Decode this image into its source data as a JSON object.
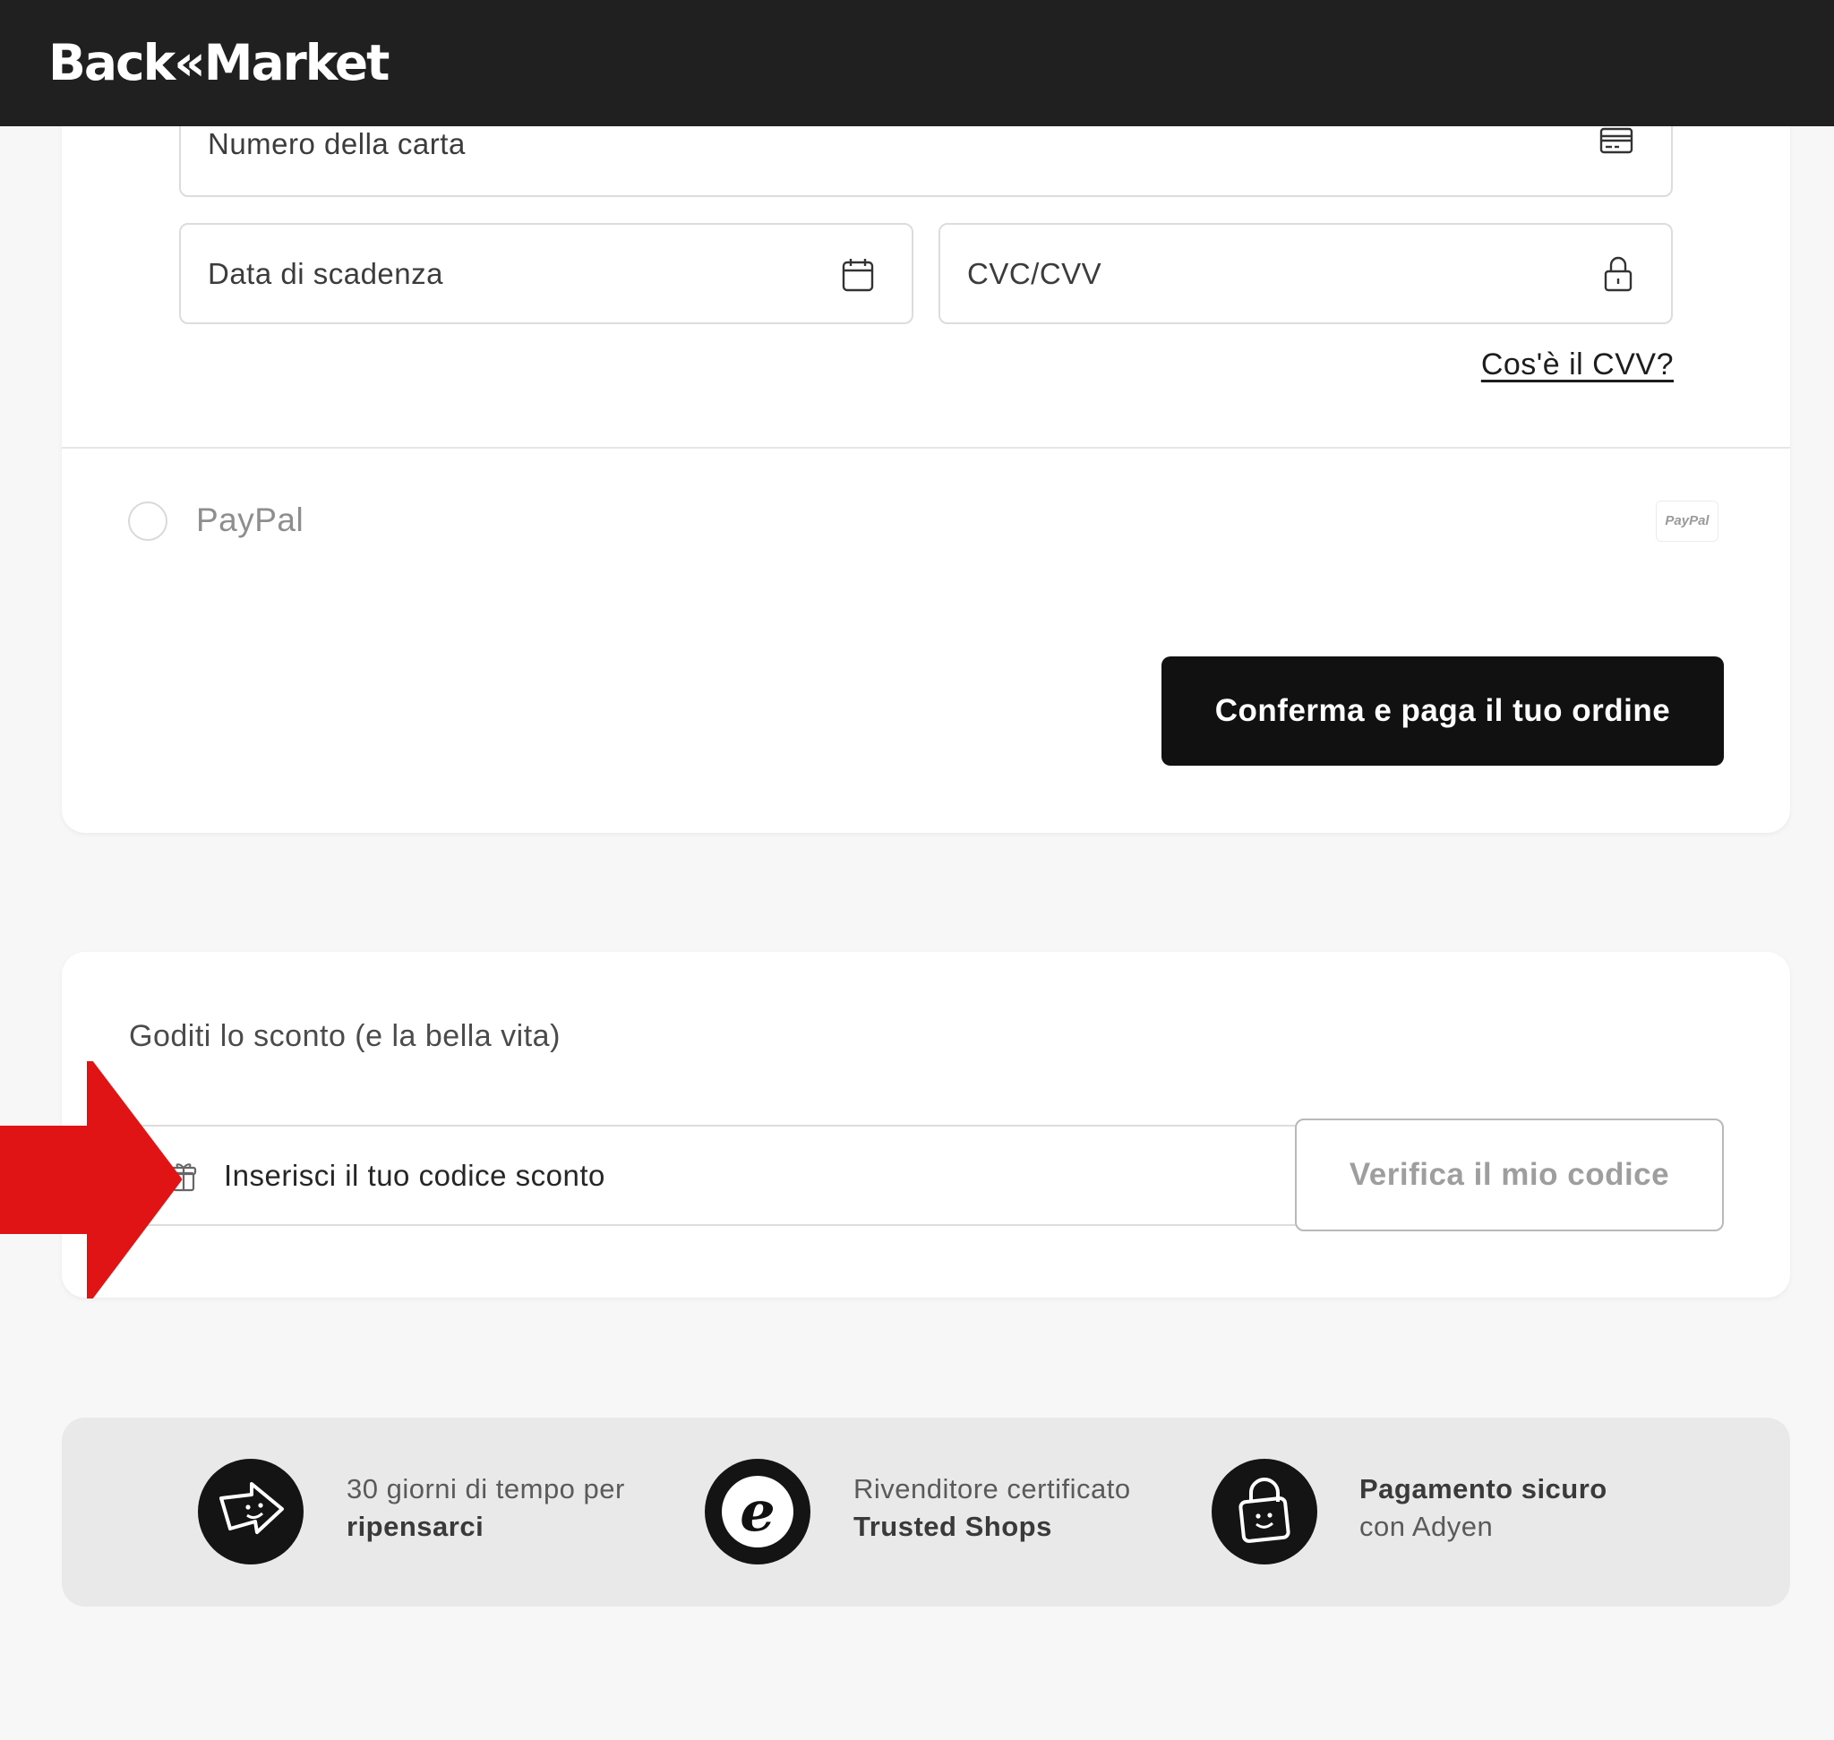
{
  "header": {
    "logo_text": "Back«Market"
  },
  "card_form": {
    "card_number_placeholder": "Numero della carta",
    "expiry_placeholder": "Data di scadenza",
    "cvc_placeholder": "CVC/CVV",
    "cvv_help_link": "Cos'è il CVV?",
    "card_icon": "credit-card-icon",
    "calendar_icon": "calendar-icon",
    "lock_icon": "lock-icon"
  },
  "payment_methods": {
    "paypal_label": "PayPal",
    "paypal_logo_text": "PayPal",
    "paypal_selected": false
  },
  "confirm_button": "Conferma e paga il tuo ordine",
  "discount": {
    "title": "Goditi lo sconto (e la bella vita)",
    "input_placeholder": "Inserisci il tuo codice sconto",
    "verify_button": "Verifica il mio codice",
    "gift_icon": "gift-icon"
  },
  "trust": [
    {
      "line1": "30 giorni di tempo per",
      "line2": "ripensarci",
      "icon": "return-arrow-icon"
    },
    {
      "line1": "Rivenditore certificato",
      "line2": "Trusted Shops",
      "icon": "trusted-shops-icon"
    },
    {
      "line1": "Pagamento sicuro",
      "line2": "con Adyen",
      "icon": "secure-lock-icon"
    }
  ],
  "colors": {
    "header_bg": "#202020",
    "page_bg": "#f7f7f7",
    "primary_button": "#111111",
    "annotation_arrow": "#e01414"
  }
}
